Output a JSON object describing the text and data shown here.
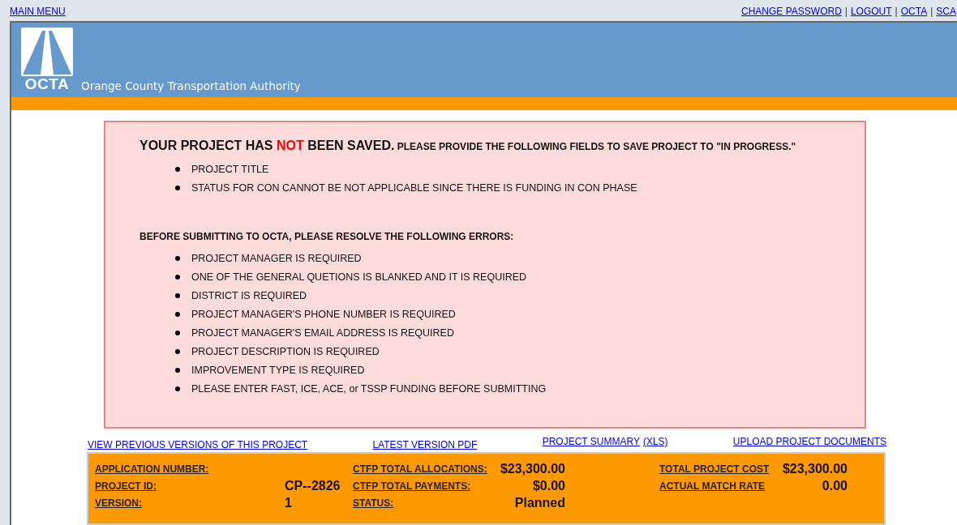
{
  "top_bar": {
    "main_menu": "MAIN MENU",
    "links": [
      "CHANGE PASSWORD",
      "LOGOUT",
      "OCTA",
      "SCA"
    ],
    "separator": "|"
  },
  "header": {
    "logo_text": "OCTA",
    "org_name": "Orange County Transportation Authority"
  },
  "save_notice": {
    "lead": "YOUR PROJECT HAS ",
    "flag": "NOT",
    "after": " BEEN SAVED.",
    "rest": " PLEASE PROVIDE THE FOLLOWING FIELDS TO SAVE PROJECT TO \"IN PROGRESS.\"",
    "items": [
      "PROJECT TITLE",
      "STATUS FOR CON CANNOT BE NOT APPLICABLE SINCE THERE IS FUNDING IN CON PHASE"
    ]
  },
  "submit_errors": {
    "heading": "BEFORE SUBMITTING TO OCTA, PLEASE RESOLVE THE FOLLOWING ERRORS:",
    "items": [
      "PROJECT MANAGER IS REQUIRED",
      "ONE OF THE GENERAL QUETIONS IS BLANKED AND IT IS REQUIRED",
      "DISTRICT IS REQUIRED",
      "PROJECT MANAGER'S PHONE NUMBER IS REQUIRED",
      "PROJECT MANAGER'S EMAIL ADDRESS IS REQUIRED",
      "PROJECT DESCRIPTION IS REQUIRED",
      "IMPROVEMENT TYPE IS REQUIRED",
      "PLEASE ENTER FAST, ICE, ACE, or TSSP FUNDING BEFORE SUBMITTING"
    ]
  },
  "project_links": {
    "previous_versions": "VIEW PREVIOUS VERSIONS OF THIS PROJECT",
    "latest_pdf": "LATEST VERSION PDF",
    "summary": "PROJECT SUMMARY",
    "summary_xls": "(XLS)",
    "upload": "UPLOAD PROJECT DOCUMENTS"
  },
  "summary_panel": {
    "columns": [
      [
        {
          "label": "APPLICATION NUMBER:"
        },
        {
          "label": "PROJECT ID:",
          "value": "CP--2826"
        },
        {
          "label": "VERSION:",
          "value": "1"
        }
      ],
      [
        {
          "label": "CTFP TOTAL ALLOCATIONS:",
          "value": "$23,300.00"
        },
        {
          "label": "CTFP TOTAL PAYMENTS:",
          "value": "$0.00"
        },
        {
          "label": "STATUS:",
          "value": "Planned"
        }
      ],
      [
        {
          "label": "TOTAL PROJECT COST",
          "value": "$23,300.00"
        },
        {
          "label": "ACTUAL MATCH RATE",
          "value": "0.00"
        }
      ]
    ]
  }
}
